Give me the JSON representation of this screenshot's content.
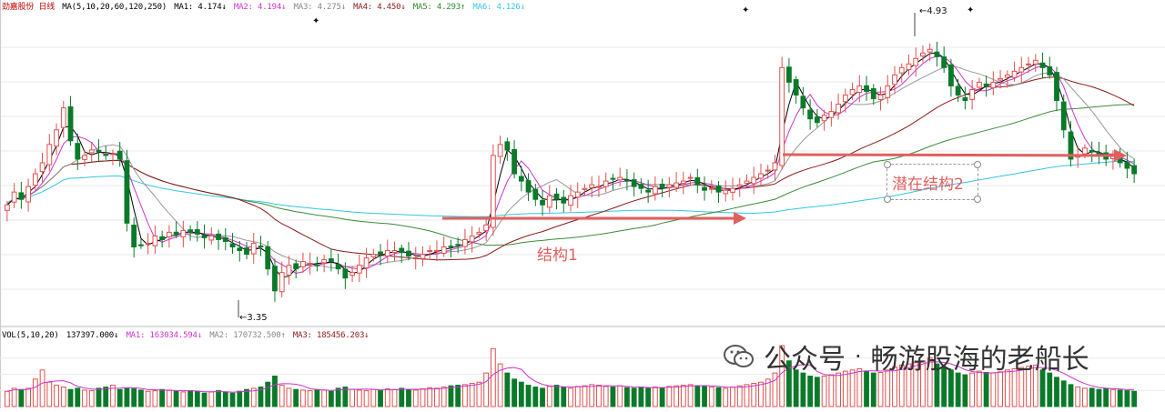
{
  "header": {
    "stock_name": "劲嘉股份",
    "period": "日线",
    "ma_spec": "MA(5,10,20,60,120,250)",
    "ma1": "MA1: 4.174↓",
    "ma2": "MA2: 4.194↓",
    "ma3": "MA3: 4.275↓",
    "ma4": "MA4: 4.450↓",
    "ma5": "MA5: 4.293↑",
    "ma6": "MA6: 4.126↓"
  },
  "volume_header": {
    "spec": "VOL(5,10,20)",
    "vol": "137397.000↓",
    "ma1": "MA1: 163034.594↓",
    "ma2": "MA2: 170732.500↑",
    "ma3": "MA3: 185456.203↓"
  },
  "annotations": {
    "high_label": "4.93",
    "low_label": "3.35",
    "structure1": "结构1",
    "structure2": "潜在结构2"
  },
  "watermark": {
    "text1": "公众号",
    "separator": "·",
    "text2": "畅游股海的老船长"
  },
  "colors": {
    "up": "#e05050",
    "down": "#0a7a2a",
    "ma1": "#000000",
    "ma2": "#cc33cc",
    "ma3": "#999999",
    "ma4": "#8b1a1a",
    "ma5": "#3c8a3c",
    "ma6": "#33c6e0",
    "arrow": "#e06060"
  },
  "chart_data": {
    "type": "candlestick",
    "price_range": [
      3.3,
      5.0
    ],
    "high": 4.93,
    "low": 3.35,
    "closes": [
      3.95,
      4.02,
      3.98,
      4.05,
      4.12,
      4.18,
      4.28,
      4.36,
      4.48,
      4.3,
      4.2,
      4.22,
      4.25,
      4.24,
      4.22,
      4.23,
      4.2,
      3.85,
      3.72,
      3.73,
      3.74,
      3.78,
      3.76,
      3.8,
      3.79,
      3.81,
      3.8,
      3.79,
      3.77,
      3.78,
      3.76,
      3.75,
      3.72,
      3.7,
      3.68,
      3.74,
      3.72,
      3.6,
      3.48,
      3.58,
      3.62,
      3.6,
      3.64,
      3.63,
      3.62,
      3.65,
      3.64,
      3.6,
      3.55,
      3.58,
      3.62,
      3.66,
      3.68,
      3.68,
      3.7,
      3.7,
      3.69,
      3.67,
      3.66,
      3.68,
      3.7,
      3.7,
      3.72,
      3.72,
      3.73,
      3.76,
      3.78,
      3.8,
      3.84,
      4.22,
      4.28,
      4.25,
      4.12,
      4.08,
      4.02,
      3.98,
      3.95,
      4.0,
      3.98,
      3.96,
      4.0,
      4.02,
      4.04,
      4.06,
      4.05,
      4.08,
      4.09,
      4.1,
      4.08,
      4.05,
      4.04,
      4.02,
      4.05,
      4.04,
      4.06,
      4.07,
      4.08,
      4.1,
      4.06,
      4.03,
      4.04,
      4.02,
      4.03,
      4.04,
      4.06,
      4.08,
      4.1,
      4.12,
      4.14,
      4.18,
      4.7,
      4.62,
      4.55,
      4.48,
      4.42,
      4.4,
      4.44,
      4.46,
      4.5,
      4.55,
      4.58,
      4.6,
      4.57,
      4.53,
      4.55,
      4.6,
      4.66,
      4.7,
      4.72,
      4.75,
      4.78,
      4.8,
      4.76,
      4.7,
      4.6,
      4.55,
      4.52,
      4.58,
      4.62,
      4.6,
      4.62,
      4.64,
      4.66,
      4.68,
      4.7,
      4.72,
      4.74,
      4.7,
      4.66,
      4.52,
      4.36,
      4.2,
      4.22,
      4.26,
      4.24,
      4.22,
      4.2,
      4.22,
      4.18,
      4.15,
      4.12
    ],
    "volumes": [
      0.25,
      0.3,
      0.28,
      0.3,
      0.45,
      0.6,
      0.4,
      0.35,
      0.32,
      0.28,
      0.3,
      0.27,
      0.26,
      0.3,
      0.32,
      0.35,
      0.28,
      0.3,
      0.29,
      0.27,
      0.25,
      0.26,
      0.28,
      0.27,
      0.25,
      0.24,
      0.26,
      0.25,
      0.22,
      0.24,
      0.26,
      0.24,
      0.22,
      0.25,
      0.28,
      0.3,
      0.32,
      0.4,
      0.5,
      0.35,
      0.3,
      0.28,
      0.27,
      0.26,
      0.28,
      0.27,
      0.25,
      0.3,
      0.32,
      0.28,
      0.27,
      0.26,
      0.28,
      0.27,
      0.29,
      0.28,
      0.3,
      0.28,
      0.27,
      0.29,
      0.31,
      0.3,
      0.32,
      0.34,
      0.35,
      0.36,
      0.38,
      0.4,
      0.55,
      0.95,
      0.7,
      0.55,
      0.45,
      0.4,
      0.35,
      0.32,
      0.3,
      0.33,
      0.35,
      0.32,
      0.3,
      0.33,
      0.34,
      0.36,
      0.35,
      0.33,
      0.32,
      0.34,
      0.31,
      0.3,
      0.32,
      0.3,
      0.32,
      0.31,
      0.33,
      0.34,
      0.35,
      0.36,
      0.34,
      0.33,
      0.32,
      0.31,
      0.3,
      0.32,
      0.34,
      0.36,
      0.38,
      0.4,
      0.45,
      0.55,
      1.0,
      0.75,
      0.6,
      0.55,
      0.5,
      0.48,
      0.5,
      0.52,
      0.55,
      0.58,
      0.6,
      0.62,
      0.58,
      0.55,
      0.56,
      0.6,
      0.65,
      0.68,
      0.7,
      0.72,
      0.75,
      0.8,
      0.7,
      0.65,
      0.6,
      0.55,
      0.52,
      0.55,
      0.58,
      0.56,
      0.55,
      0.57,
      0.6,
      0.62,
      0.64,
      0.66,
      0.68,
      0.6,
      0.55,
      0.48,
      0.42,
      0.36,
      0.32,
      0.3,
      0.3,
      0.28,
      0.3,
      0.28,
      0.27,
      0.26,
      0.25
    ]
  }
}
